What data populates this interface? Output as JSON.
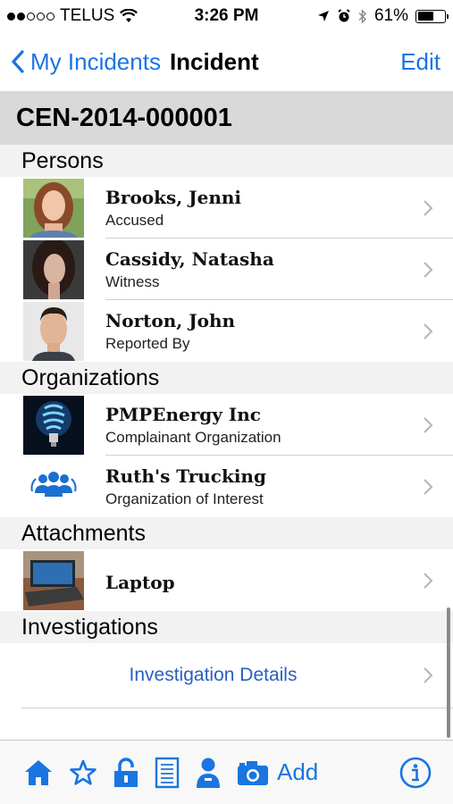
{
  "status_bar": {
    "carrier": "TELUS",
    "signal_filled": 2,
    "signal_total": 5,
    "time": "3:26 PM",
    "battery_percent": "61%",
    "battery_level": 0.61
  },
  "nav": {
    "back_label": "My Incidents",
    "title": "Incident",
    "edit_label": "Edit"
  },
  "incident_id": "CEN-2014-000001",
  "sections": {
    "persons": {
      "header": "Persons",
      "items": [
        {
          "name": "Brooks, Jenni",
          "role": "Accused"
        },
        {
          "name": "Cassidy, Natasha",
          "role": "Witness"
        },
        {
          "name": "Norton, John",
          "role": "Reported By"
        }
      ]
    },
    "organizations": {
      "header": "Organizations",
      "items": [
        {
          "name": "PMPEnergy Inc",
          "role": "Complainant Organization"
        },
        {
          "name": "Ruth's Trucking",
          "role": "Organization of Interest"
        }
      ]
    },
    "attachments": {
      "header": "Attachments",
      "items": [
        {
          "name": "Laptop"
        }
      ]
    },
    "investigations": {
      "header": "Investigations",
      "link": "Investigation Details"
    }
  },
  "toolbar": {
    "add_label": "Add",
    "icons": [
      "home-icon",
      "star-icon",
      "lock-icon",
      "notes-icon",
      "person-icon",
      "camera-icon",
      "info-icon"
    ]
  },
  "colors": {
    "accent": "#1a75e0",
    "link": "#2a5fbf",
    "incident_bar": "#d9d9d9",
    "section_header": "#f2f2f2"
  }
}
